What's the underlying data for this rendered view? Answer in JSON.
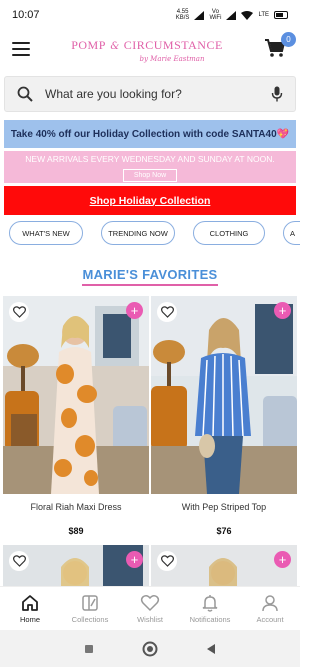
{
  "status": {
    "time": "10:07",
    "speed_value": "4.55",
    "speed_unit": "KB/S",
    "vo_label": "Vo",
    "wifi_label": "WiFi",
    "lte_label": "LTE",
    "battery_color": "#111111"
  },
  "header": {
    "logo_left": "POMP",
    "logo_amp": "&",
    "logo_right": "CIRCUMSTANCE",
    "logo_sub": "by Marie Eastman",
    "cart_count": "0"
  },
  "search": {
    "placeholder": "What are you looking for?"
  },
  "promos": {
    "blue_text": "Take 40% off our Holiday Collection with code SANTA40💖",
    "pink_text": "NEW ARRIVALS EVERY WEDNESDAY AND SUNDAY AT NOON.",
    "pink_button": "Shop Now",
    "red_text": "Shop Holiday Collection"
  },
  "categories": [
    "WHAT'S NEW",
    "TRENDING NOW",
    "CLOTHING",
    "A"
  ],
  "section": {
    "title": "MARIE'S FAVORITES"
  },
  "products": [
    {
      "name": "Floral Riah Maxi Dress",
      "price": "$89"
    },
    {
      "name": "With Pep Striped Top",
      "price": "$76"
    }
  ],
  "bottom_nav": [
    {
      "label": "Home",
      "icon": "home-icon",
      "active": true
    },
    {
      "label": "Collections",
      "icon": "collections-icon",
      "active": false
    },
    {
      "label": "Wishlist",
      "icon": "heart-icon",
      "active": false
    },
    {
      "label": "Notifications",
      "icon": "bell-icon",
      "active": false
    },
    {
      "label": "Account",
      "icon": "user-icon",
      "active": false
    }
  ],
  "colors": {
    "brand_pink": "#e060a8",
    "accent_blue": "#4a8fd8",
    "promo_blue": "#9ec1ec",
    "promo_pink": "#f5b9d8",
    "promo_red": "#ff0a0a",
    "add_button": "#ea5bb3"
  }
}
